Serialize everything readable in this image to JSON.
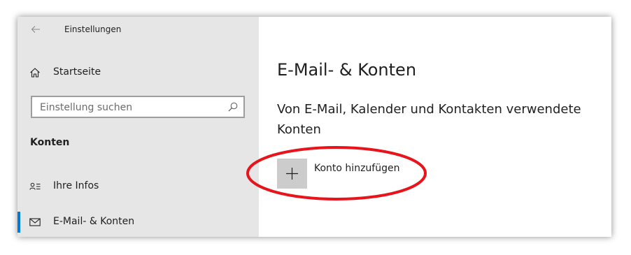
{
  "window": {
    "title": "Einstellungen"
  },
  "sidebar": {
    "home_label": "Startseite",
    "search_placeholder": "Einstellung suchen",
    "section_title": "Konten",
    "items": [
      {
        "label": "Ihre Infos",
        "icon": "person-list-icon"
      },
      {
        "label": "E-Mail- & Konten",
        "icon": "mail-icon",
        "active": true
      }
    ]
  },
  "main": {
    "page_title": "E-Mail- & Konten",
    "subtitle": "Von E-Mail, Kalender und Kontakten verwendete Konten",
    "add_account_label": "Konto hinzufügen"
  },
  "colors": {
    "sidebar_bg": "#e6e6e6",
    "accent": "#0078d7",
    "plus_tile": "#cccccc",
    "annotation": "#e8141b"
  }
}
